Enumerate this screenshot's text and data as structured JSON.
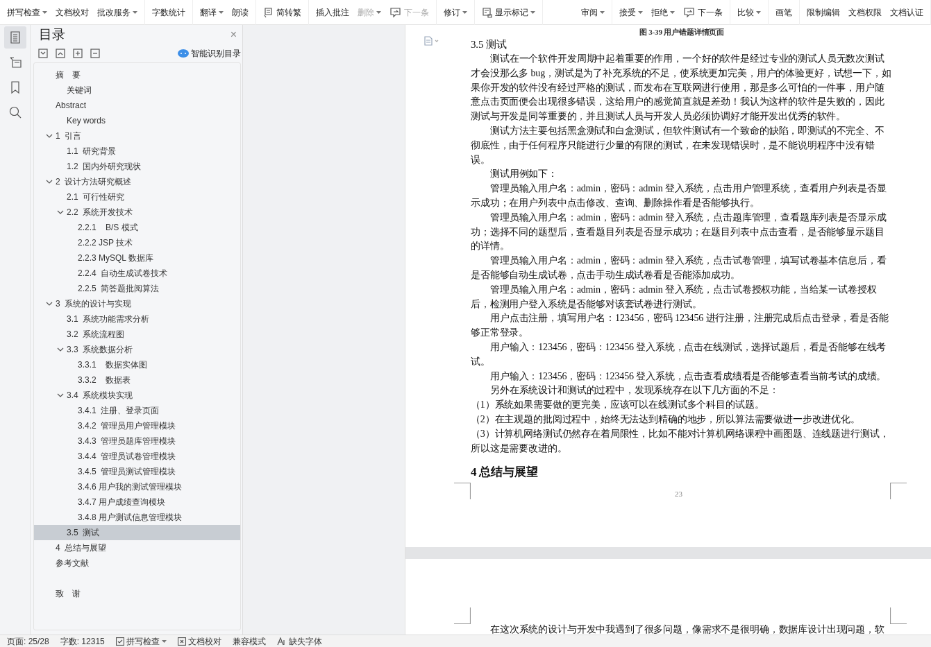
{
  "toolbar": {
    "left": [
      {
        "items": [
          {
            "label": "拼写检查",
            "kind": "text",
            "dropdown": true,
            "disabled": false
          },
          {
            "label": "文档校对",
            "kind": "text",
            "dropdown": false,
            "disabled": false
          },
          {
            "label": "批改服务",
            "kind": "text",
            "dropdown": true,
            "disabled": false
          }
        ]
      },
      {
        "items": [
          {
            "label": "字数统计",
            "kind": "text",
            "dropdown": false,
            "disabled": false
          }
        ]
      },
      {
        "items": [
          {
            "label": "翻译",
            "kind": "text",
            "dropdown": true,
            "disabled": false
          },
          {
            "label": "朗读",
            "kind": "text",
            "dropdown": false,
            "disabled": false
          }
        ]
      },
      {
        "items": [
          {
            "label": "简转繁",
            "kind": "convert",
            "dropdown": false,
            "disabled": false
          }
        ]
      },
      {
        "items": [
          {
            "label": "插入批注",
            "kind": "text",
            "dropdown": false,
            "disabled": false
          },
          {
            "label": "删除",
            "kind": "text",
            "dropdown": true,
            "disabled": true
          },
          {
            "label": "下一条",
            "kind": "next",
            "dropdown": false,
            "disabled": true
          }
        ]
      },
      {
        "items": [
          {
            "label": "修订",
            "kind": "text",
            "dropdown": true,
            "disabled": false
          }
        ]
      },
      {
        "items": [
          {
            "label": "显示标记",
            "kind": "markup",
            "dropdown": true,
            "disabled": false
          }
        ]
      }
    ],
    "right": [
      {
        "items": [
          {
            "label": "审阅",
            "kind": "text",
            "dropdown": true,
            "disabled": false
          }
        ]
      },
      {
        "items": [
          {
            "label": "接受",
            "kind": "text",
            "dropdown": true,
            "disabled": false
          },
          {
            "label": "拒绝",
            "kind": "text",
            "dropdown": true,
            "disabled": false
          },
          {
            "label": "下一条",
            "kind": "next",
            "dropdown": false,
            "disabled": false
          }
        ]
      },
      {
        "items": [
          {
            "label": "比较",
            "kind": "text",
            "dropdown": true,
            "disabled": false
          }
        ]
      },
      {
        "items": [
          {
            "label": "画笔",
            "kind": "text",
            "dropdown": false,
            "disabled": false
          }
        ]
      },
      {
        "items": [
          {
            "label": "限制编辑",
            "kind": "text",
            "dropdown": false,
            "disabled": false
          },
          {
            "label": "文档权限",
            "kind": "text",
            "dropdown": false,
            "disabled": false
          },
          {
            "label": "文档认证",
            "kind": "text",
            "dropdown": false,
            "disabled": false
          }
        ]
      }
    ]
  },
  "rail": [
    {
      "kind": "toc",
      "selected": true
    },
    {
      "kind": "outline",
      "selected": false
    },
    {
      "kind": "bookmark",
      "selected": false
    },
    {
      "kind": "search",
      "selected": false
    }
  ],
  "toc_panel": {
    "title": "目录",
    "close": "×",
    "smart_button": "智能识别目录",
    "items": [
      {
        "label": "摘　要",
        "selected": false,
        "children": [
          {
            "label": "关键词",
            "selected": false
          }
        ]
      },
      {
        "label": "Abstract",
        "selected": false,
        "children": [
          {
            "label": "Key words",
            "selected": false
          }
        ]
      },
      {
        "label": "1  引言",
        "selected": false,
        "expanded": true,
        "children": [
          {
            "label": "1.1  研究背景",
            "selected": false
          },
          {
            "label": "1.2  国内外研究现状",
            "selected": false
          }
        ]
      },
      {
        "label": "2  设计方法研究概述",
        "selected": false,
        "expanded": true,
        "children": [
          {
            "label": "2.1  可行性研究",
            "selected": false
          },
          {
            "label": "2.2  系统开发技术",
            "selected": false,
            "expanded": true,
            "children": [
              {
                "label": "2.2.1    B/S 模式",
                "selected": false
              },
              {
                "label": "2.2.2 JSP 技术",
                "selected": false
              },
              {
                "label": "2.2.3 MySQL 数据库",
                "selected": false
              },
              {
                "label": "2.2.4  自动生成试卷技术",
                "selected": false
              },
              {
                "label": "2.2.5  简答题批阅算法",
                "selected": false
              }
            ]
          }
        ]
      },
      {
        "label": "3  系统的设计与实现",
        "selected": false,
        "expanded": true,
        "children": [
          {
            "label": "3.1  系统功能需求分析",
            "selected": false
          },
          {
            "label": "3.2  系统流程图",
            "selected": false
          },
          {
            "label": "3.3  系统数据分析",
            "selected": false,
            "expanded": true,
            "children": [
              {
                "label": "3.3.1    数据实体图",
                "selected": false
              },
              {
                "label": "3.3.2    数据表",
                "selected": false
              }
            ]
          },
          {
            "label": "3.4  系统模块实现",
            "selected": false,
            "expanded": true,
            "children": [
              {
                "label": "3.4.1  注册、登录页面",
                "selected": false
              },
              {
                "label": "3.4.2  管理员用户管理模块",
                "selected": false
              },
              {
                "label": "3.4.3  管理员题库管理模块",
                "selected": false
              },
              {
                "label": "3.4.4  管理员试卷管理模块",
                "selected": false
              },
              {
                "label": "3.4.5  管理员测试管理模块",
                "selected": false
              },
              {
                "label": "3.4.6 用户我的测试管理模块",
                "selected": false
              },
              {
                "label": "3.4.7 用户成绩查询模块",
                "selected": false
              },
              {
                "label": "3.4.8 用户测试信息管理模块",
                "selected": false
              }
            ]
          },
          {
            "label": "3.5  测试",
            "selected": true
          }
        ]
      },
      {
        "label": "4  总结与展望",
        "selected": false
      },
      {
        "label": "参考文献",
        "selected": false
      },
      {
        "label": "致　谢",
        "selected": false
      }
    ]
  },
  "document": {
    "page": [
      {
        "kind": "caption",
        "text": "图 3-39 用户错题详情页面"
      },
      {
        "kind": "heading",
        "text": "3.5  测试"
      },
      {
        "kind": "para",
        "text": "测试在一个软件开发周期中起着重要的作用，一个好的软件是经过专业的测试人员无数次测试才会没那么多 bug，测试是为了补充系统的不足，使系统更加完美，用户的体验更好，试想一下，如果你开发的软件没有经过严格的测试，而发布在互联网进行使用，那是多么可怕的一件事，用户随意点击页面便会出现很多错误，这给用户的感觉简直就是差劲！我认为这样的软件是失败的，因此测试与开发是同等重要的，并且测试人员与开发人员必须协调好才能开发出优秀的软件。"
      },
      {
        "kind": "para",
        "text": "测试方法主要包括黑盒测试和白盒测试，但软件测试有一个致命的缺陷，即测试的不完全、不彻底性，由于任何程序只能进行少量的有限的测试，在未发现错误时，是不能说明程序中没有错误。"
      },
      {
        "kind": "para",
        "text": "测试用例如下："
      },
      {
        "kind": "para",
        "text": "管理员输入用户名：admin，密码：admin 登入系统，点击用户管理系统，查看用户列表是否显示成功；在用户列表中点击修改、查询、删除操作看是否能够执行。"
      },
      {
        "kind": "para",
        "text": "管理员输入用户名：admin，密码：admin 登入系统，点击题库管理，查看题库列表是否显示成功；选择不同的题型后，查看题目列表是否显示成功；在题目列表中点击查看，是否能够显示题目的详情。"
      },
      {
        "kind": "para",
        "text": "管理员输入用户名：admin，密码：admin 登入系统，点击试卷管理，填写试卷基本信息后，看是否能够自动生成试卷，点击手动生成试卷看是否能添加成功。"
      },
      {
        "kind": "para",
        "text": "管理员输入用户名：admin，密码：admin 登入系统，点击试卷授权功能，当给某一试卷授权后，检测用户登入系统是否能够对该套试卷进行测试。"
      },
      {
        "kind": "para",
        "text": "用户点击注册，填写用户名：123456，密码 123456 进行注册，注册完成后点击登录，看是否能够正常登录。"
      },
      {
        "kind": "para",
        "text": "用户输入：123456，密码：123456 登入系统，点击在线测试，选择试题后，看是否能够在线考试。"
      },
      {
        "kind": "para",
        "text": "用户输入：123456，密码：123456 登入系统，点击查看成绩看是否能够查看当前考试的成绩。"
      },
      {
        "kind": "para",
        "text": "另外在系统设计和测试的过程中，发现系统存在以下几方面的不足："
      },
      {
        "kind": "list",
        "text": "（1）系统如果需要做的更完美，应该可以在线测试多个科目的试题。"
      },
      {
        "kind": "list",
        "text": "（2）在主观题的批阅过程中，始终无法达到精确的地步，所以算法需要做进一步改进优化。"
      },
      {
        "kind": "list",
        "text": "（3）计算机网络测试仍然存在着局限性，比如不能对计算机网络课程中画图题、连线题进行测试，所以这是需要改进的。"
      },
      {
        "kind": "heading2",
        "text": "4  总结与展望"
      }
    ],
    "page_number": "23",
    "next_page": [
      {
        "kind": "para",
        "text": "在这次系统的设计与开发中我遇到了很多问题，像需求不是很明确，数据库设计出现问题，软"
      }
    ]
  },
  "status_bar": [
    {
      "kind": "text",
      "label": "页面: 25/28"
    },
    {
      "kind": "text",
      "label": "字数: 12315"
    },
    {
      "kind": "check",
      "label": "拼写检查",
      "dropdown": true
    },
    {
      "kind": "cross",
      "label": "文档校对"
    },
    {
      "kind": "text",
      "label": "兼容模式"
    },
    {
      "kind": "font",
      "label": "缺失字体"
    }
  ]
}
